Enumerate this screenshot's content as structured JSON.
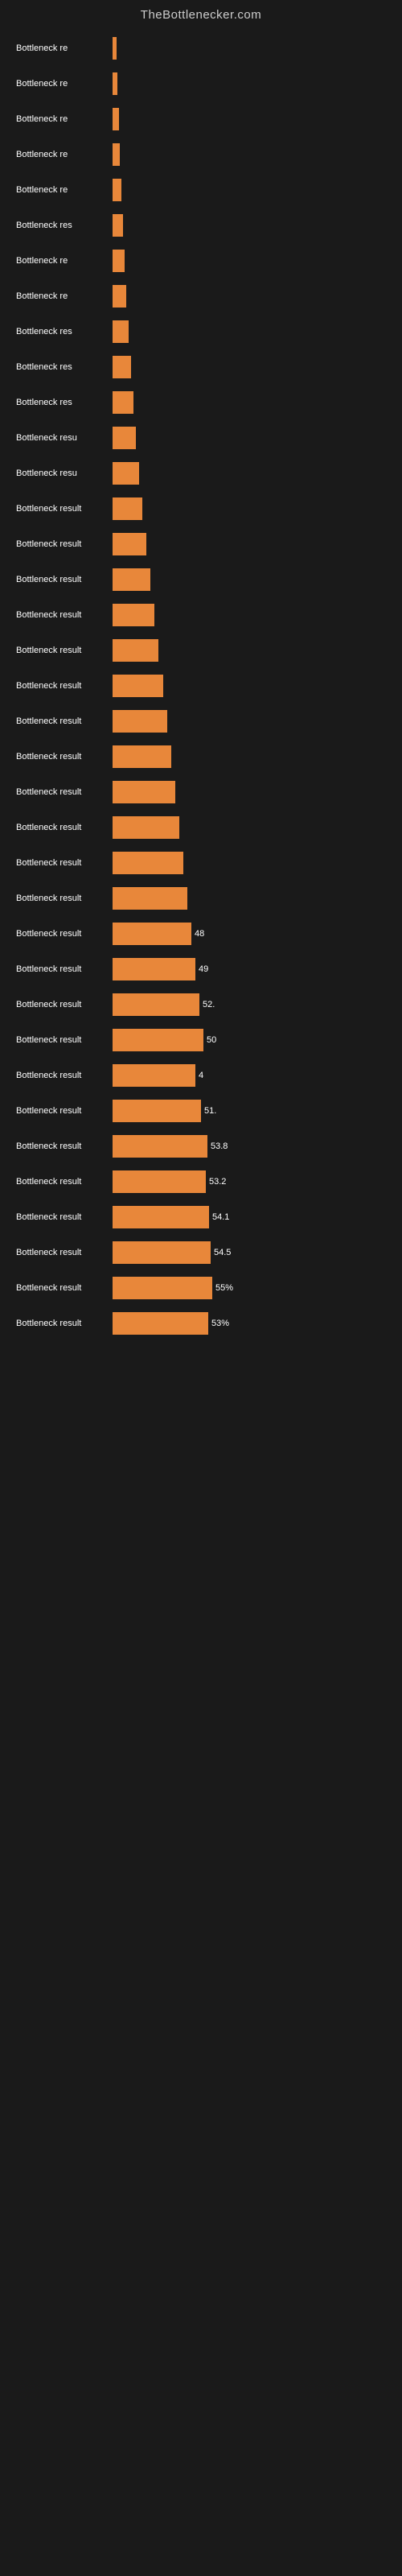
{
  "header": {
    "title": "TheBottlenecker.com"
  },
  "bars": [
    {
      "label": "Bottleneck re",
      "width": 5,
      "value": ""
    },
    {
      "label": "Bottleneck re",
      "width": 6,
      "value": ""
    },
    {
      "label": "Bottleneck re",
      "width": 8,
      "value": ""
    },
    {
      "label": "Bottleneck re",
      "width": 9,
      "value": ""
    },
    {
      "label": "Bottleneck re",
      "width": 11,
      "value": ""
    },
    {
      "label": "Bottleneck res",
      "width": 13,
      "value": ""
    },
    {
      "label": "Bottleneck re",
      "width": 15,
      "value": ""
    },
    {
      "label": "Bottleneck re",
      "width": 17,
      "value": ""
    },
    {
      "label": "Bottleneck res",
      "width": 20,
      "value": ""
    },
    {
      "label": "Bottleneck res",
      "width": 23,
      "value": ""
    },
    {
      "label": "Bottleneck res",
      "width": 26,
      "value": ""
    },
    {
      "label": "Bottleneck resu",
      "width": 29,
      "value": ""
    },
    {
      "label": "Bottleneck resu",
      "width": 33,
      "value": ""
    },
    {
      "label": "Bottleneck result",
      "width": 37,
      "value": ""
    },
    {
      "label": "Bottleneck result",
      "width": 42,
      "value": ""
    },
    {
      "label": "Bottleneck result",
      "width": 47,
      "value": ""
    },
    {
      "label": "Bottleneck result",
      "width": 52,
      "value": ""
    },
    {
      "label": "Bottleneck result",
      "width": 57,
      "value": ""
    },
    {
      "label": "Bottleneck result",
      "width": 63,
      "value": ""
    },
    {
      "label": "Bottleneck result",
      "width": 68,
      "value": ""
    },
    {
      "label": "Bottleneck result",
      "width": 73,
      "value": ""
    },
    {
      "label": "Bottleneck result",
      "width": 78,
      "value": ""
    },
    {
      "label": "Bottleneck result",
      "width": 83,
      "value": ""
    },
    {
      "label": "Bottleneck result",
      "width": 88,
      "value": ""
    },
    {
      "label": "Bottleneck result",
      "width": 93,
      "value": ""
    },
    {
      "label": "Bottleneck result",
      "width": 98,
      "value": "48"
    },
    {
      "label": "Bottleneck result",
      "width": 103,
      "value": "49"
    },
    {
      "label": "Bottleneck result",
      "width": 108,
      "value": "52."
    },
    {
      "label": "Bottleneck result",
      "width": 113,
      "value": "50"
    },
    {
      "label": "Bottleneck result",
      "width": 103,
      "value": "4"
    },
    {
      "label": "Bottleneck result",
      "width": 110,
      "value": "51."
    },
    {
      "label": "Bottleneck result",
      "width": 118,
      "value": "53.8"
    },
    {
      "label": "Bottleneck result",
      "width": 116,
      "value": "53.2"
    },
    {
      "label": "Bottleneck result",
      "width": 120,
      "value": "54.1"
    },
    {
      "label": "Bottleneck result",
      "width": 122,
      "value": "54.5"
    },
    {
      "label": "Bottleneck result",
      "width": 124,
      "value": "55%"
    },
    {
      "label": "Bottleneck result",
      "width": 119,
      "value": "53%"
    }
  ]
}
